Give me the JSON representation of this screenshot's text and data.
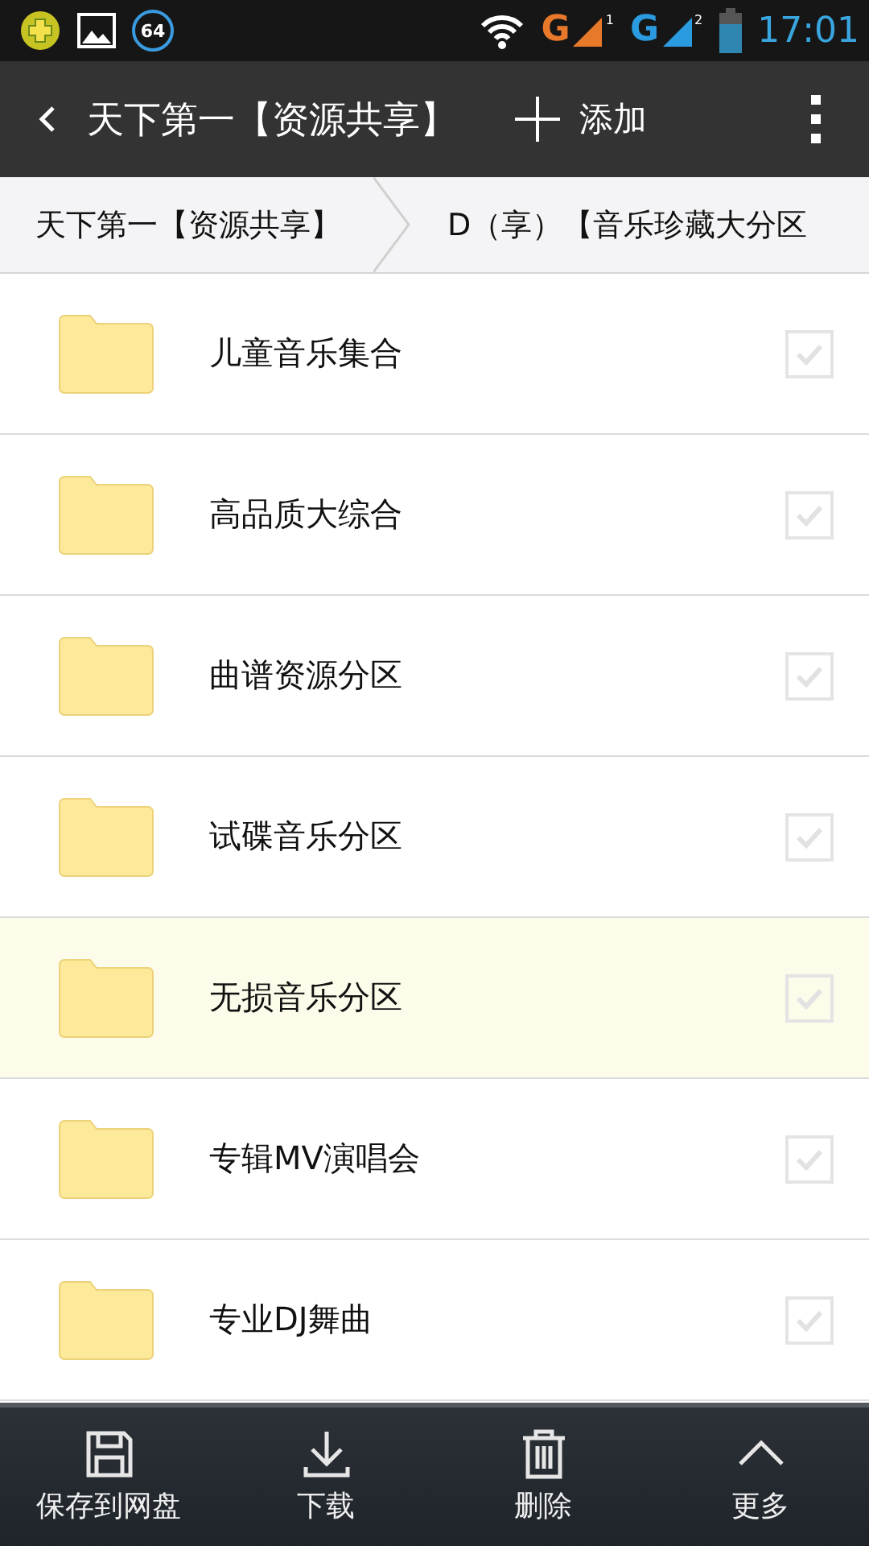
{
  "status_bar": {
    "badge": "64",
    "time": "17:01",
    "networks": [
      {
        "label": "G",
        "sim": "1",
        "color": "#e8782a"
      },
      {
        "label": "G",
        "sim": "2",
        "color": "#2b9be0"
      }
    ]
  },
  "toolbar": {
    "title": "天下第一【资源共享】",
    "add_label": "添加"
  },
  "breadcrumb": [
    "天下第一【资源共享】",
    "D（享）【音乐珍藏大分区"
  ],
  "folders": [
    {
      "name": "儿童音乐集合",
      "selected": false,
      "checked": false
    },
    {
      "name": "高品质大综合",
      "selected": false,
      "checked": false
    },
    {
      "name": "曲谱资源分区",
      "selected": false,
      "checked": false
    },
    {
      "name": "试碟音乐分区",
      "selected": false,
      "checked": false
    },
    {
      "name": "无损音乐分区",
      "selected": true,
      "checked": false
    },
    {
      "name": "专辑MV演唱会",
      "selected": false,
      "checked": false
    },
    {
      "name": "专业DJ舞曲",
      "selected": false,
      "checked": false
    }
  ],
  "actions": [
    {
      "kind": "save",
      "label": "保存到网盘"
    },
    {
      "kind": "download",
      "label": "下载"
    },
    {
      "kind": "delete",
      "label": "删除"
    },
    {
      "kind": "more",
      "label": "更多"
    }
  ]
}
